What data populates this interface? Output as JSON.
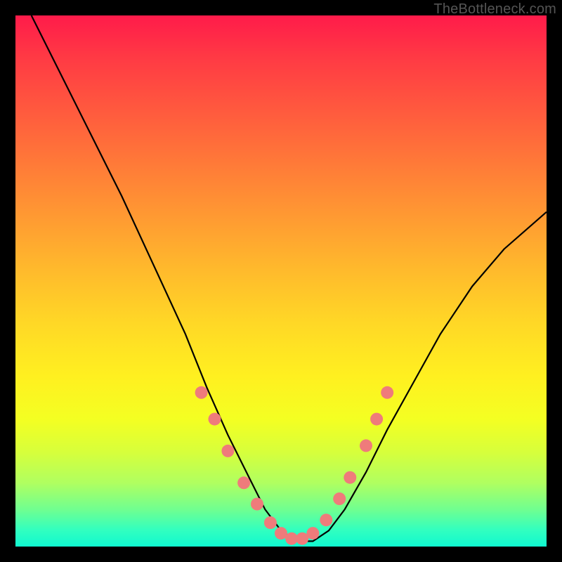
{
  "watermark": "TheBottleneck.com",
  "chart_data": {
    "type": "line",
    "title": "",
    "xlabel": "",
    "ylabel": "",
    "xlim": [
      0,
      100
    ],
    "ylim": [
      0,
      100
    ],
    "series": [
      {
        "name": "curve",
        "x": [
          3,
          8,
          14,
          20,
          26,
          32,
          36,
          40,
          44,
          47,
          50,
          53,
          56,
          59,
          62,
          66,
          70,
          75,
          80,
          86,
          92,
          100
        ],
        "y": [
          100,
          90,
          78,
          66,
          53,
          40,
          30,
          21,
          13,
          7,
          3,
          1,
          1,
          3,
          7,
          14,
          22,
          31,
          40,
          49,
          56,
          63
        ]
      }
    ],
    "markers": {
      "name": "highlighted-points",
      "color": "#ef7b7b",
      "x": [
        35,
        37.5,
        40,
        43,
        45.5,
        48,
        50,
        52,
        54,
        56,
        58.5,
        61,
        63,
        66,
        68,
        70
      ],
      "y": [
        29,
        24,
        18,
        12,
        8,
        4.5,
        2.5,
        1.5,
        1.5,
        2.5,
        5,
        9,
        13,
        19,
        24,
        29
      ]
    }
  }
}
